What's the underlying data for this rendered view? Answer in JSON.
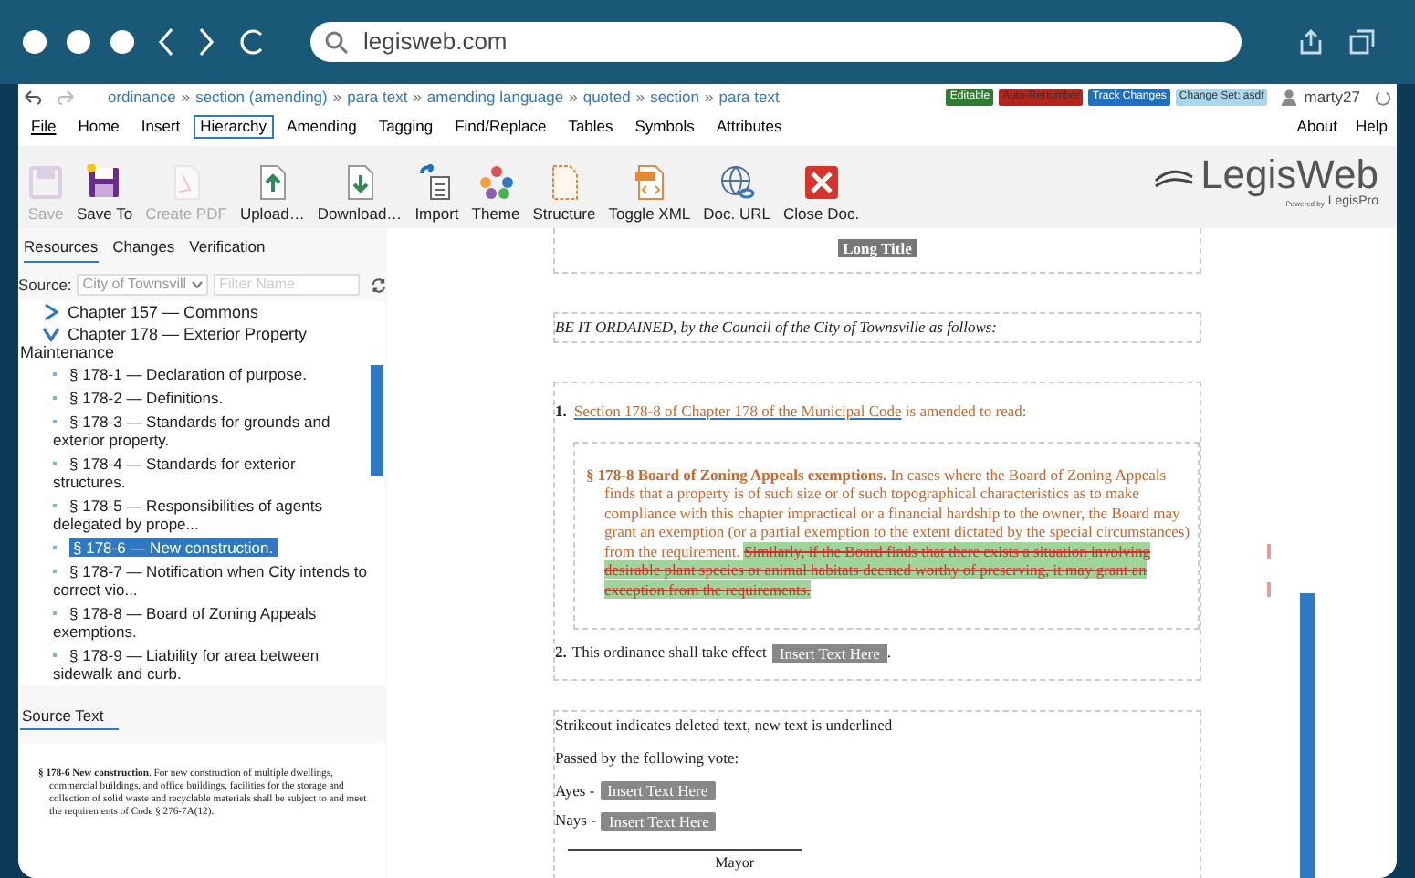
{
  "browser": {
    "url": "legisweb.com"
  },
  "breadcrumb": {
    "separator": "»",
    "items": [
      "ordinance",
      "section (amending)",
      "para text",
      "amending language",
      "quoted",
      "section",
      "para text"
    ]
  },
  "badges": [
    {
      "label": "Editable",
      "color": "#2e7d32"
    },
    {
      "label": "Auto-Renumber",
      "color": "#b3261e"
    },
    {
      "label": "Track Changes",
      "color": "#1f6fbf"
    },
    {
      "label": "Change Set: asdf",
      "color": "#a9d6ea"
    }
  ],
  "user": "marty27",
  "menu": [
    {
      "label": "File",
      "selected": false
    },
    {
      "label": "Home",
      "selected": false
    },
    {
      "label": "Insert",
      "selected": false
    },
    {
      "label": "Hierarchy",
      "selected": true
    },
    {
      "label": "Amending",
      "selected": false
    },
    {
      "label": "Tagging",
      "selected": false
    },
    {
      "label": "Find/Replace",
      "selected": false
    },
    {
      "label": "Tables",
      "selected": false
    },
    {
      "label": "Symbols",
      "selected": false
    },
    {
      "label": "Attributes",
      "selected": false
    }
  ],
  "menu_right": [
    "About",
    "Help"
  ],
  "toolbar": [
    {
      "label": "Save",
      "disabled": true
    },
    {
      "label": "Save To",
      "disabled": false
    },
    {
      "label": "Create PDF",
      "disabled": true
    },
    {
      "label": "Upload…",
      "disabled": false
    },
    {
      "label": "Download…",
      "disabled": false
    },
    {
      "label": "Import",
      "disabled": false
    },
    {
      "label": "Theme",
      "disabled": false
    },
    {
      "label": "Structure",
      "disabled": false
    },
    {
      "label": "Toggle XML",
      "disabled": false
    },
    {
      "label": "Doc. URL",
      "disabled": false
    },
    {
      "label": "Close Doc.",
      "disabled": false
    }
  ],
  "logo": {
    "name": "LegisWeb",
    "tagline": "Powered by",
    "brand": "LegisPro"
  },
  "panel_tabs": [
    {
      "label": "Resources",
      "selected": true
    },
    {
      "label": "Changes",
      "selected": false
    },
    {
      "label": "Verification",
      "selected": false
    }
  ],
  "source": {
    "label": "Source:",
    "value": "City of Townsvill",
    "placeholder": "Filter Name"
  },
  "tree": [
    {
      "label": "Chapter 157 — Commons",
      "expanded": false
    },
    {
      "label": "Chapter 178 — Exterior Property Maintenance",
      "expanded": true,
      "children": [
        {
          "label": "§ 178-1 — Declaration of purpose.",
          "selected": false
        },
        {
          "label": "§ 178-2 — Definitions.",
          "selected": false
        },
        {
          "label": "§ 178-3 — Standards for grounds and exterior property.",
          "selected": false
        },
        {
          "label": "§ 178-4 — Standards for exterior structures.",
          "selected": false
        },
        {
          "label": "§ 178-5 — Responsibilities of agents delegated by prope...",
          "selected": false
        },
        {
          "label": "§ 178-6 — New construction.",
          "selected": true
        },
        {
          "label": "§ 178-7 — Notification when City intends to correct vio...",
          "selected": false
        },
        {
          "label": "§ 178-8 — Board of Zoning Appeals exemptions.",
          "selected": false
        },
        {
          "label": "§ 178-9 — Liability for area between sidewalk and curb.",
          "selected": false
        }
      ]
    }
  ],
  "source_text": {
    "title": "Source Text",
    "text": "**§ 178-6  New construction**. For new construction of multiple dwellings, commercial buildings, and office buildings, facilities for the storage and collection of solid waste and recyclable materials shall be subject to and meet the requirements of Code § 276-7A(12)."
  },
  "document": {
    "long_title": "Long Title",
    "enacting": "BE IT ORDAINED, by the Council of the City of Townsville as follows:",
    "section_1": {
      "num": "1.",
      "segments": [
        {
          "kind": "inserted",
          "text": "Section 178-8 of Chapter 178 of the Municipal Code"
        },
        {
          "kind": "text",
          "text": " is amended to read:"
        }
      ],
      "quoted": [
        {
          "kind": "heading",
          "text": "§ 178-8  Board of Zoning Appeals exemptions."
        },
        {
          "kind": "text",
          "text": " In cases where the Board of Zoning Appeals finds that a property is of such size or of such topographical characteristics as to make compliance with this chapter impractical or a financial hardship to the owner, the Board may grant an exemption (or a partial exemption to the extent dictated by the special circumstances) from the requirement. "
        },
        {
          "kind": "deleted",
          "text": "Similarly, if the Board finds that there exists a situation involving desirable plant species or animal habitats deemed worthy of preserving, it may grant an exception from the requirements."
        }
      ]
    },
    "section_2": {
      "num": "2.",
      "text": "This ordinance shall take effect",
      "placeholder": "Insert Text Here",
      "end": "."
    },
    "note": "Strikeout indicates deleted text, new text is underlined",
    "passed": "Passed by the following vote:",
    "votes": [
      {
        "label": "Ayes -",
        "placeholder": "Insert Text Here"
      },
      {
        "label": "Nays -",
        "placeholder": "Insert Text Here"
      }
    ],
    "signature": "Mayor"
  }
}
